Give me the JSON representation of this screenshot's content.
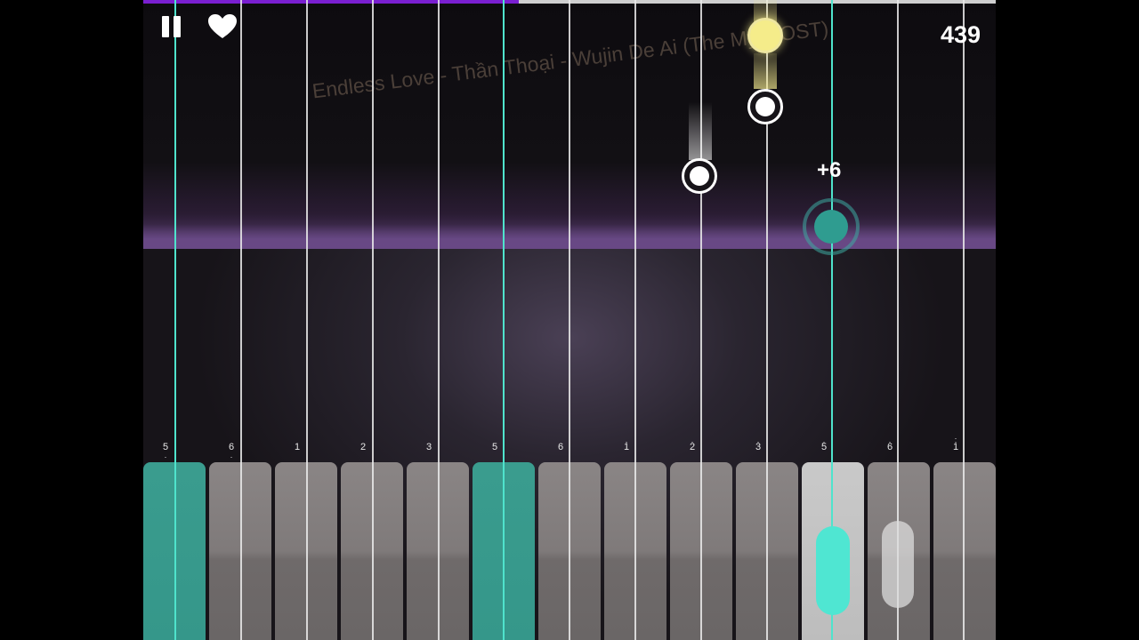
{
  "song_title": "Endless Love - Thần Thoại - Wujin De Ai (The Myth OST)",
  "score": "439",
  "bonus": "+6",
  "progress": 0.44,
  "colors": {
    "accent": "#4fe3cc",
    "progress": "#7a1fd1"
  },
  "icons": {
    "pause": "pause-icon",
    "like": "heart-icon"
  },
  "keys": [
    {
      "label": "5",
      "dot_top": "",
      "dot_bottom": "."
    },
    {
      "label": "6",
      "dot_top": "",
      "dot_bottom": "."
    },
    {
      "label": "1",
      "dot_top": "",
      "dot_bottom": ""
    },
    {
      "label": "2",
      "dot_top": "",
      "dot_bottom": ""
    },
    {
      "label": "3",
      "dot_top": "",
      "dot_bottom": ""
    },
    {
      "label": "5",
      "dot_top": "",
      "dot_bottom": ""
    },
    {
      "label": "6",
      "dot_top": "",
      "dot_bottom": ""
    },
    {
      "label": "1",
      "dot_top": ".",
      "dot_bottom": ""
    },
    {
      "label": "2",
      "dot_top": ".",
      "dot_bottom": ""
    },
    {
      "label": "3",
      "dot_top": ".",
      "dot_bottom": ""
    },
    {
      "label": "5",
      "dot_top": ".",
      "dot_bottom": ""
    },
    {
      "label": "6",
      "dot_top": ".",
      "dot_bottom": ""
    },
    {
      "label": "1",
      "dot_top": ":",
      "dot_bottom": ""
    }
  ]
}
